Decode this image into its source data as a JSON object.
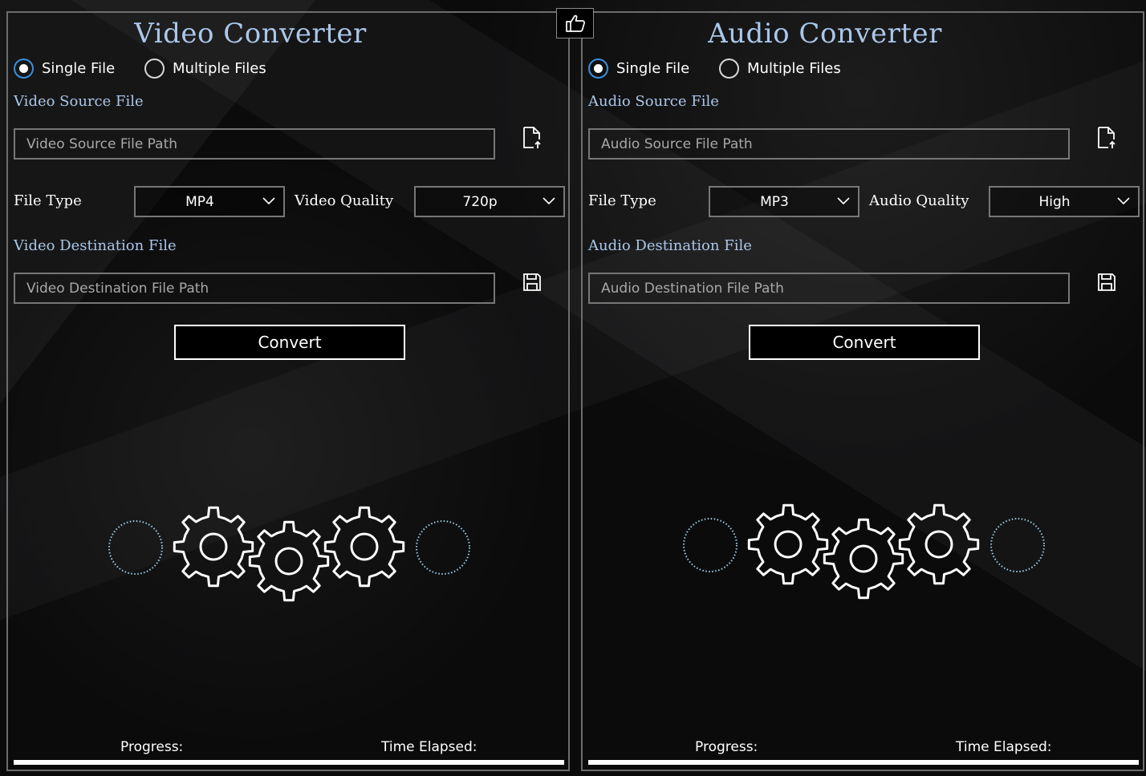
{
  "video": {
    "title": "Video Converter",
    "mode_single": "Single File",
    "mode_multiple": "Multiple Files",
    "selected_mode": "Single File",
    "source_label": "Video Source File",
    "source_placeholder": "Video Source File Path",
    "source_value": "",
    "file_type_label": "File Type",
    "file_type_value": "MP4",
    "quality_label": "Video Quality",
    "quality_value": "720p",
    "destination_label": "Video Destination File",
    "destination_placeholder": "Video Destination File Path",
    "destination_value": "",
    "convert_label": "Convert",
    "progress_label": "Progress:",
    "time_label": "Time Elapsed:",
    "progress_fraction": 0
  },
  "audio": {
    "title": "Audio Converter",
    "mode_single": "Single File",
    "mode_multiple": "Multiple Files",
    "selected_mode": "Single File",
    "source_label": "Audio Source File",
    "source_placeholder": "Audio Source File Path",
    "source_value": "",
    "file_type_label": "File Type",
    "file_type_value": "MP3",
    "quality_label": "Audio Quality",
    "quality_value": "High",
    "destination_label": "Audio Destination File",
    "destination_placeholder": "Audio Destination File Path",
    "destination_value": "",
    "convert_label": "Convert",
    "progress_label": "Progress:",
    "time_label": "Time Elapsed:",
    "progress_fraction": 0
  },
  "icons": {
    "open_file": "open-file-icon",
    "save": "save-icon",
    "dropdown": "chevron-down-icon",
    "center": "thumbs-up-icon",
    "busy": "gears-icon"
  },
  "colors": {
    "accent_title": "#aac7ea",
    "radio_selected": "#3b8ede",
    "border": "#777777",
    "background": "#0b0b0c"
  }
}
